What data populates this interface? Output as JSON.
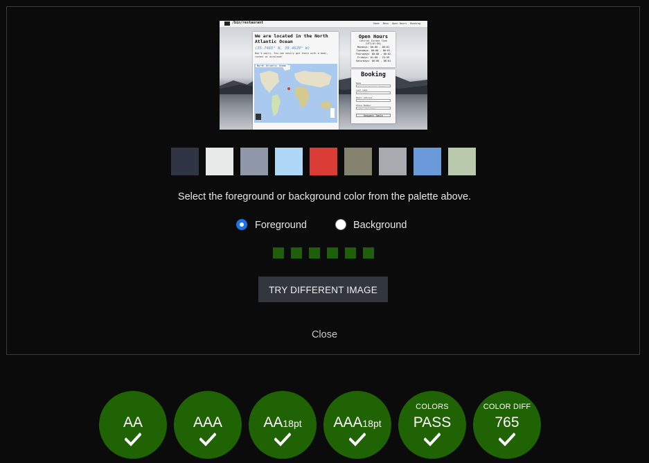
{
  "preview": {
    "brand": "/bin/restaurant",
    "nav": [
      "Home",
      "Menu",
      "Open Hours",
      "Booking"
    ],
    "location": {
      "title": "We are located in the North Atlantic Ocean",
      "coords": "(35.7465° N, 39.4629° W)",
      "note": "Don't worry. You can easily get there with a boat, rocket or airplane!",
      "map_label": "North Atlantic Ocean"
    },
    "hours": {
      "title": "Open Hours",
      "subtitle": "Central Europe Time (UTC+01:00)",
      "lines": [
        "Mondays: 00:00 - 00:01",
        "Tuesdays: 00:00 - 00:01",
        "Thursdays: 00:00 - 00:02",
        "Fridays: 01:00 - 23:59",
        "Saturdays: 00:00 - 00:01"
      ]
    },
    "booking": {
      "title": "Booking",
      "name_label": "Name",
      "name_placeholder": "Jean-Luc Picard, Arrows, ...",
      "lastname_label": "Last name",
      "lastname_placeholder": "Last Name",
      "email_label": "Email address",
      "email_placeholder": "name@example.com",
      "phone_label": "Phone Number",
      "phone_placeholder": "(555) 555-5555",
      "button": "Request Table"
    }
  },
  "palette": [
    "#303545",
    "#e8eaea",
    "#8f98a8",
    "#afd8f6",
    "#db3d36",
    "#858370",
    "#a9aab0",
    "#6a9ad9",
    "#b9c9ab"
  ],
  "instruction": "Select the foreground or background color from the palette above.",
  "mode": {
    "foreground_label": "Foreground",
    "background_label": "Background",
    "selected": "foreground"
  },
  "progress_dot_count": 6,
  "progress_color": "#1f5e0a",
  "try_button": "TRY DIFFERENT IMAGE",
  "close_link": "Close",
  "results": [
    {
      "label": "AA",
      "sub": "",
      "top": "",
      "status": "check-icon"
    },
    {
      "label": "AAA",
      "sub": "",
      "top": "",
      "status": "check-icon"
    },
    {
      "label": "AA",
      "sub": "18pt",
      "top": "",
      "status": "check-icon"
    },
    {
      "label": "AAA",
      "sub": "18pt",
      "top": "",
      "status": "check-icon"
    },
    {
      "label": "PASS",
      "sub": "",
      "top": "COLORS",
      "status": "check-icon"
    },
    {
      "label": "765",
      "sub": "",
      "top": "COLOR DIFF",
      "status": "check-icon"
    }
  ]
}
